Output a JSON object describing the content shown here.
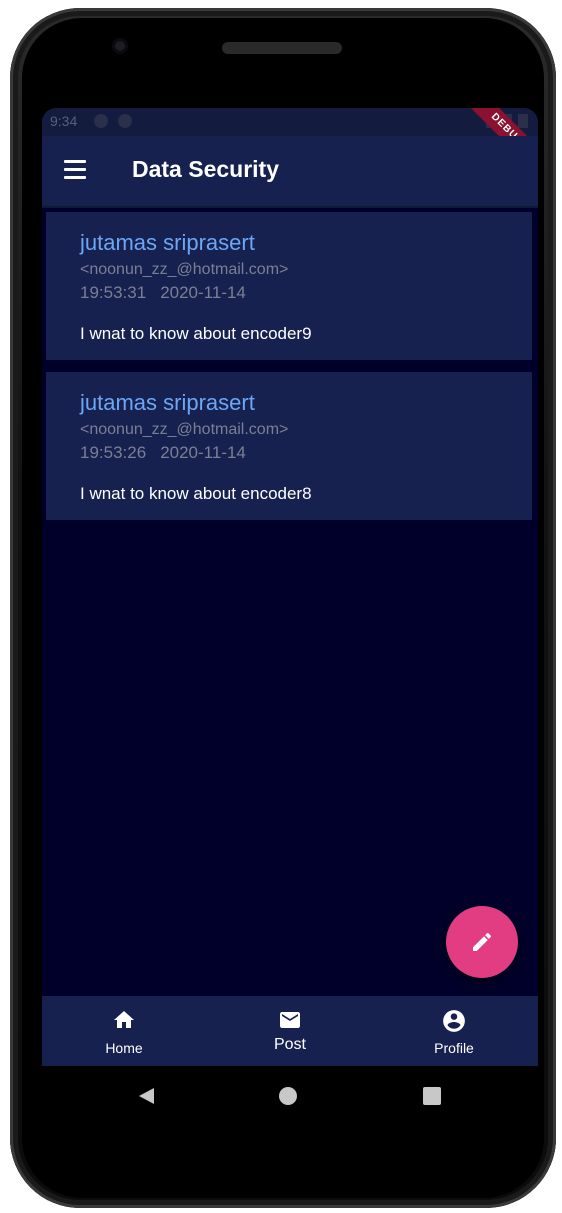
{
  "status_bar": {
    "time": "9:34",
    "debug_label": "DEBUG"
  },
  "app_bar": {
    "title": "Data Security"
  },
  "messages": [
    {
      "sender": "jutamas sriprasert",
      "email": "<noonun_zz_@hotmail.com>",
      "time": "19:53:31",
      "date": "2020-11-14",
      "body": "I wnat to know about encoder9"
    },
    {
      "sender": "jutamas sriprasert",
      "email": "<noonun_zz_@hotmail.com>",
      "time": "19:53:26",
      "date": "2020-11-14",
      "body": "I wnat to know about encoder8"
    }
  ],
  "bottom_nav": {
    "items": [
      {
        "label": "Home",
        "icon": "home-icon"
      },
      {
        "label": "Post",
        "icon": "mail-icon"
      },
      {
        "label": "Profile",
        "icon": "account-circle-icon"
      }
    ]
  },
  "colors": {
    "app_bar_bg": "#162150",
    "screen_bg": "#00002a",
    "sender_text": "#6ea6f5",
    "fab_bg": "#e23c82"
  }
}
